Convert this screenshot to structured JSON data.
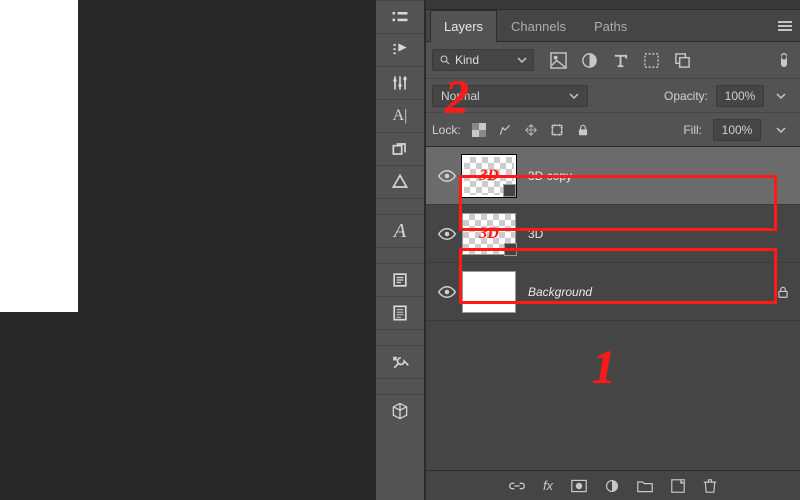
{
  "tabs": {
    "layers": "Layers",
    "channels": "Channels",
    "paths": "Paths"
  },
  "filter": {
    "kind": "Kind"
  },
  "blend": {
    "mode": "Normal",
    "opacity_label": "Opacity:",
    "opacity_value": "100%"
  },
  "lock": {
    "label": "Lock:",
    "fill_label": "Fill:",
    "fill_value": "100%"
  },
  "layers": [
    {
      "name": "3D copy",
      "thumb_text": "3D"
    },
    {
      "name": "3D",
      "thumb_text": "3D"
    },
    {
      "name": "Background"
    }
  ],
  "bottom": {
    "fx": "fx"
  },
  "toolbar": {
    "char_a": "A|",
    "glyph_a": "A"
  },
  "annotations": {
    "one": "1",
    "two": "2"
  }
}
